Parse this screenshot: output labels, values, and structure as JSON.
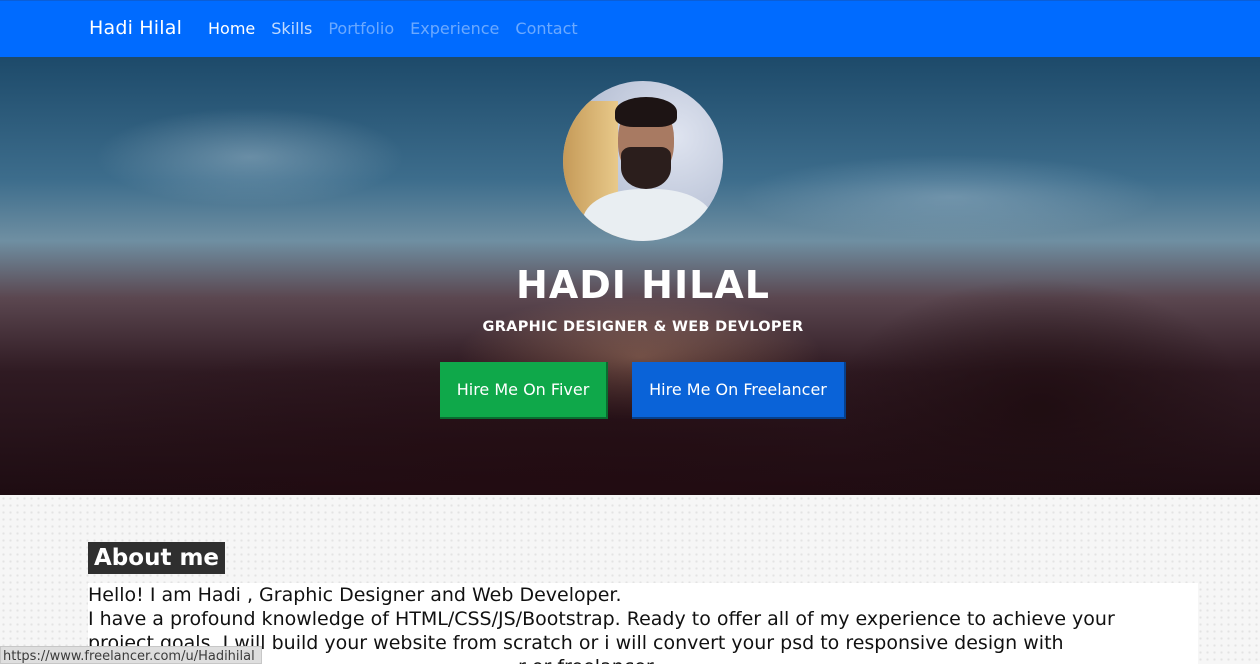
{
  "navbar": {
    "brand": "Hadi Hilal",
    "links": [
      "Home",
      "Skills",
      "Portfolio",
      "Experience",
      "Contact"
    ],
    "active": "Home"
  },
  "hero": {
    "title": "HADI HILAL",
    "subtitle": "GRAPHIC DESIGNER & WEB DEVLOPER",
    "buttons": {
      "fiverr": "Hire Me On Fiver",
      "freelancer": "Hire Me On Freelancer"
    }
  },
  "about": {
    "heading": "About me",
    "lines": [
      "Hello! I am Hadi , Graphic Designer and Web Developer.",
      "I have a profound knowledge of HTML/CSS/JS/Bootstrap. Ready to offer all of my experience to achieve your",
      "project goals. I will build your website from scratch or i will convert your psd to responsive design with",
      "r or freelancer"
    ]
  },
  "status_bar": {
    "url": "https://www.freelancer.com/u/Hadihilal"
  },
  "colors": {
    "navbar": "#006bff",
    "fiverr_button": "#0fa84a",
    "freelancer_button": "#0a63d8"
  }
}
